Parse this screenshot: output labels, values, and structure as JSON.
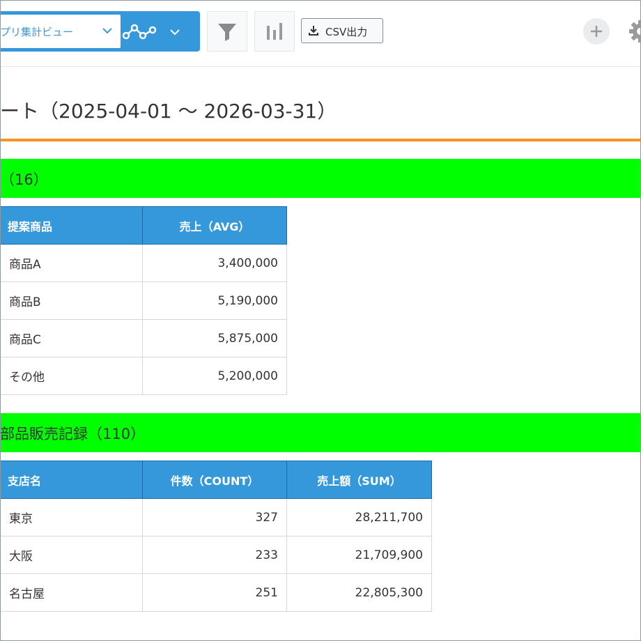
{
  "toolbar": {
    "view_selector": "プリ集計ビュー",
    "csv_label": "CSV出力"
  },
  "report": {
    "title": "ート（2025-04-01 ～ 2026-03-31）"
  },
  "section1": {
    "header": "（16）",
    "columns": [
      "提案商品",
      "売上（AVG）"
    ],
    "rows": [
      [
        "商品A",
        "3,400,000"
      ],
      [
        "商品B",
        "5,190,000"
      ],
      [
        "商品C",
        "5,875,000"
      ],
      [
        "その他",
        "5,200,000"
      ]
    ]
  },
  "section2": {
    "header": "部品販売記録（110）",
    "columns": [
      "支店名",
      "件数（COUNT）",
      "売上額（SUM）"
    ],
    "rows": [
      [
        "東京",
        "327",
        "28,211,700"
      ],
      [
        "大阪",
        "233",
        "21,709,900"
      ],
      [
        "名古屋",
        "251",
        "22,805,300"
      ]
    ]
  },
  "colors": {
    "accent": "#3498db",
    "section_bg": "#00ff00",
    "underline": "#f7941d"
  },
  "icons": [
    "chevron-down-icon",
    "line-graph-icon",
    "filter-icon",
    "bar-chart-icon",
    "download-icon",
    "plus-icon",
    "gear-icon"
  ]
}
